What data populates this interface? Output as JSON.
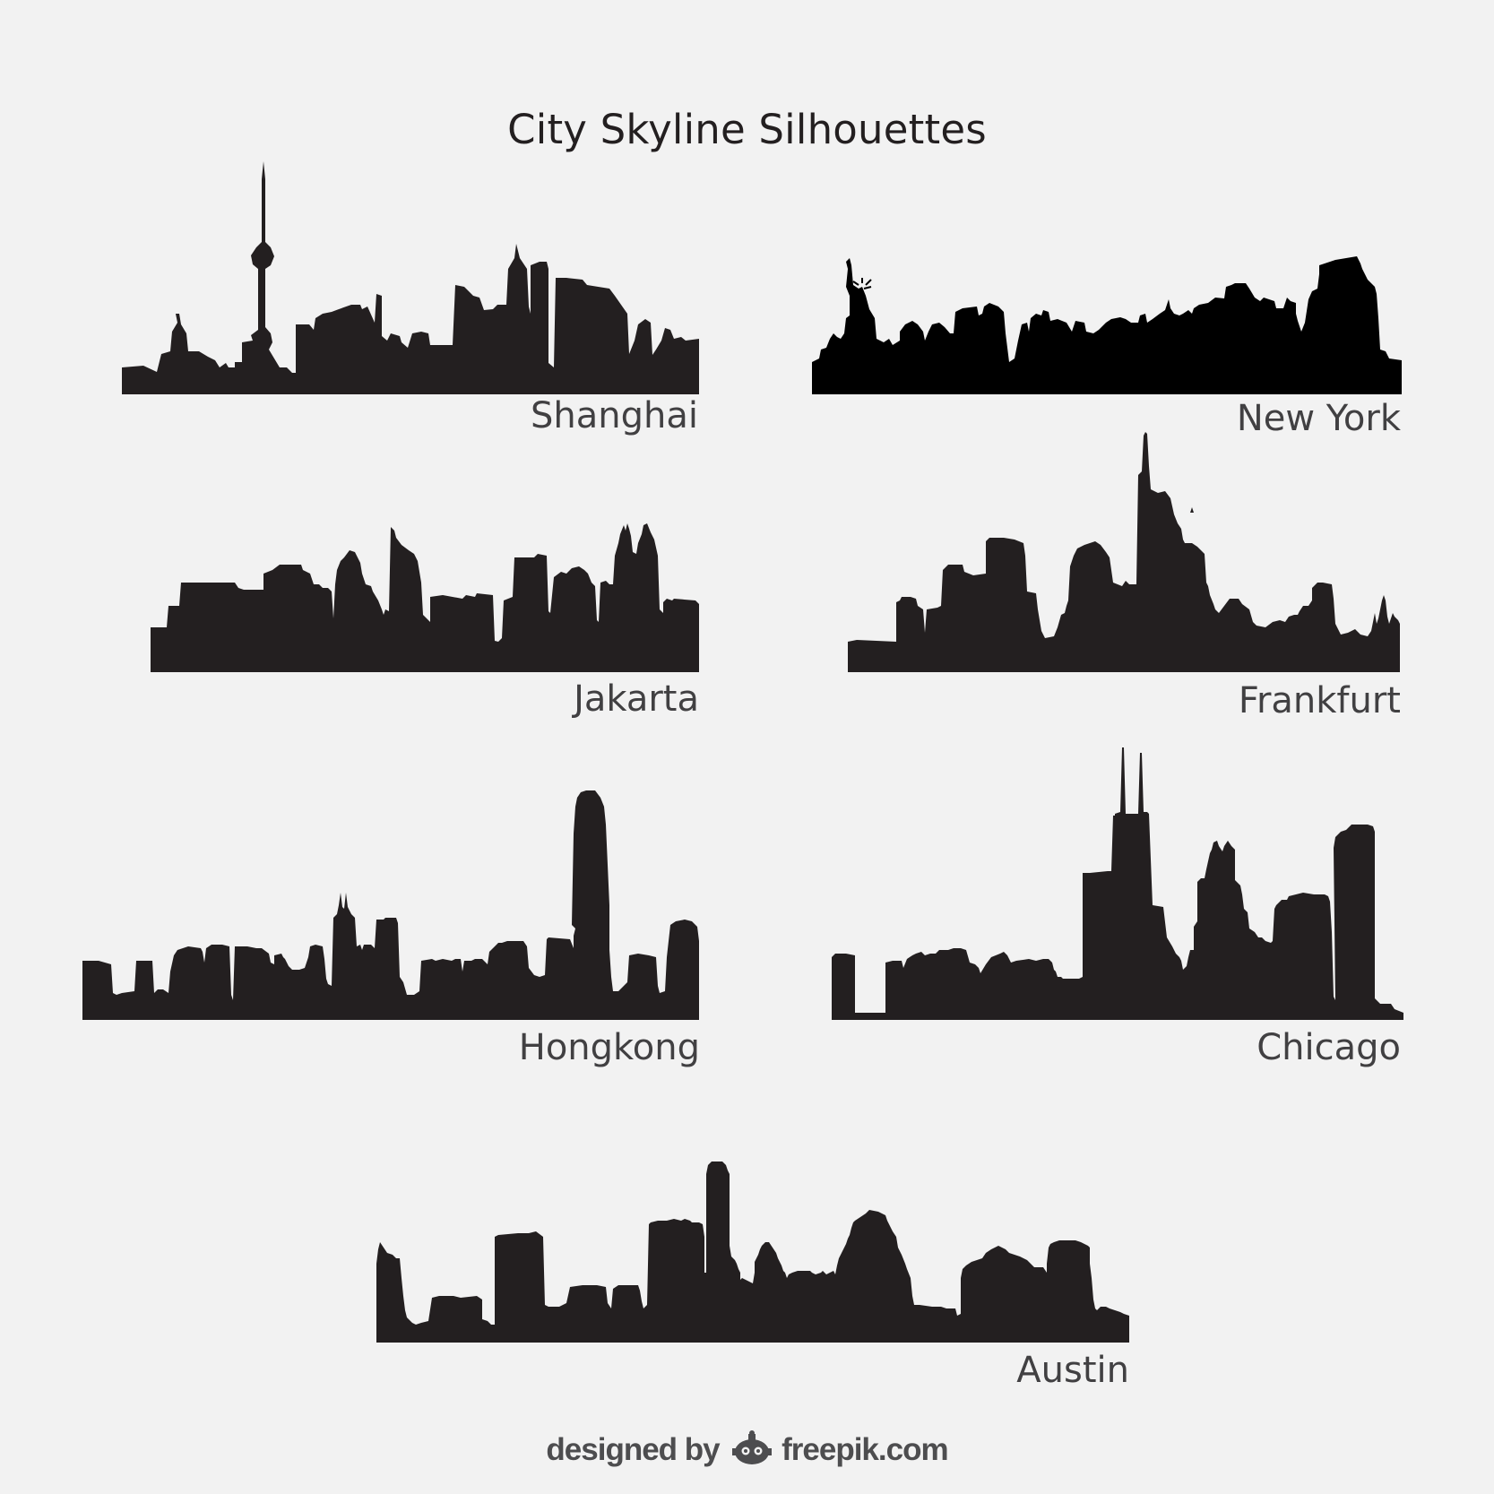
{
  "title": "City Skyline Silhouettes",
  "colors": {
    "background": "#f2f2f2",
    "silhouette": "#231f20",
    "new_york_silhouette": "#000000",
    "label": "#414042",
    "credit": "#4d4d4f"
  },
  "cities": [
    {
      "name": "Shanghai",
      "icon": "shanghai-skyline-icon"
    },
    {
      "name": "New York",
      "icon": "new-york-skyline-icon"
    },
    {
      "name": "Jakarta",
      "icon": "jakarta-skyline-icon"
    },
    {
      "name": "Frankfurt",
      "icon": "frankfurt-skyline-icon"
    },
    {
      "name": "Hongkong",
      "icon": "hongkong-skyline-icon"
    },
    {
      "name": "Chicago",
      "icon": "chicago-skyline-icon"
    },
    {
      "name": "Austin",
      "icon": "austin-skyline-icon"
    }
  ],
  "credit": {
    "prefix": "designed by",
    "brand": "freepik.com",
    "icon": "freepik-logo-icon"
  }
}
